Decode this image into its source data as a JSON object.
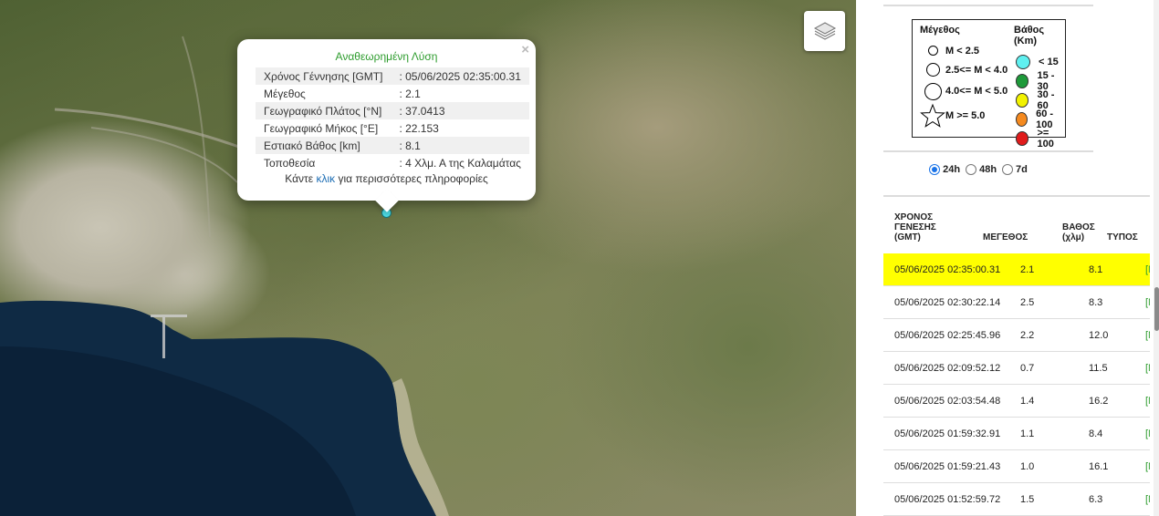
{
  "map": {
    "layers_icon": "layers-icon",
    "popup": {
      "title": "Αναθεωρημένη Λύση",
      "close": "×",
      "rows": [
        {
          "key": "Χρόνος Γέννησης [GMT]",
          "value": ": 05/06/2025 02:35:00.31"
        },
        {
          "key": "Μέγεθος",
          "value": ": 2.1"
        },
        {
          "key": "Γεωγραφικό Πλάτος [°N]",
          "value": ": 37.0413"
        },
        {
          "key": "Γεωγραφικό Μήκος [°E]",
          "value": ": 22.153"
        },
        {
          "key": "Εστιακό Βάθος [km]",
          "value": ": 8.1"
        },
        {
          "key": "Τοποθεσία",
          "value": ": 4 Χλμ. Α της Καλαμάτας"
        }
      ],
      "more_prefix": "Κάντε",
      "more_link": "κλικ",
      "more_suffix": "για περισσότερες πληροφορίες"
    },
    "marker_color": "#4fe0e8"
  },
  "legend": {
    "magnitude_title": "Μέγεθος",
    "depth_title": "Βάθος (Km)",
    "magnitudes": [
      {
        "label": "M < 2.5",
        "symbol": "small-circle-icon"
      },
      {
        "label": "2.5<= M < 4.0",
        "symbol": "medium-circle-icon"
      },
      {
        "label": "4.0<= M < 5.0",
        "symbol": "large-circle-icon"
      },
      {
        "label": "M >= 5.0",
        "symbol": "star-icon"
      }
    ],
    "depths": [
      {
        "label": "< 15",
        "color": "#5ff0f0"
      },
      {
        "label": "15 - 30",
        "color": "#1e9a3a"
      },
      {
        "label": "30 - 60",
        "color": "#f2f200"
      },
      {
        "label": "60 - 100",
        "color": "#f58a1f"
      },
      {
        "label": ">= 100",
        "color": "#e01b1b"
      }
    ]
  },
  "time_filter": {
    "options": [
      "24h",
      "48h",
      "7d"
    ],
    "selected": "24h"
  },
  "table": {
    "headers": {
      "time": [
        "ΧΡΟΝΟΣ",
        "ΓΕΝΕΣΗΣ",
        "(GMT)"
      ],
      "magnitude": "ΜΕΓΕΘΟΣ",
      "depth": [
        "ΒΑΘΟΣ",
        "(χλμ)"
      ],
      "type": "ΤΥΠΟΣ"
    },
    "rows": [
      {
        "time": "05/06/2025 02:35:00.31",
        "mag": "2.1",
        "depth": "8.1",
        "type": "[M",
        "highlight": true
      },
      {
        "time": "05/06/2025 02:30:22.14",
        "mag": "2.5",
        "depth": "8.3",
        "type": "[M"
      },
      {
        "time": "05/06/2025 02:25:45.96",
        "mag": "2.2",
        "depth": "12.0",
        "type": "[M"
      },
      {
        "time": "05/06/2025 02:09:52.12",
        "mag": "0.7",
        "depth": "11.5",
        "type": "[M"
      },
      {
        "time": "05/06/2025 02:03:54.48",
        "mag": "1.4",
        "depth": "16.2",
        "type": "[M"
      },
      {
        "time": "05/06/2025 01:59:32.91",
        "mag": "1.1",
        "depth": "8.4",
        "type": "[M"
      },
      {
        "time": "05/06/2025 01:59:21.43",
        "mag": "1.0",
        "depth": "16.1",
        "type": "[M"
      },
      {
        "time": "05/06/2025 01:52:59.72",
        "mag": "1.5",
        "depth": "6.3",
        "type": "[M"
      }
    ]
  }
}
